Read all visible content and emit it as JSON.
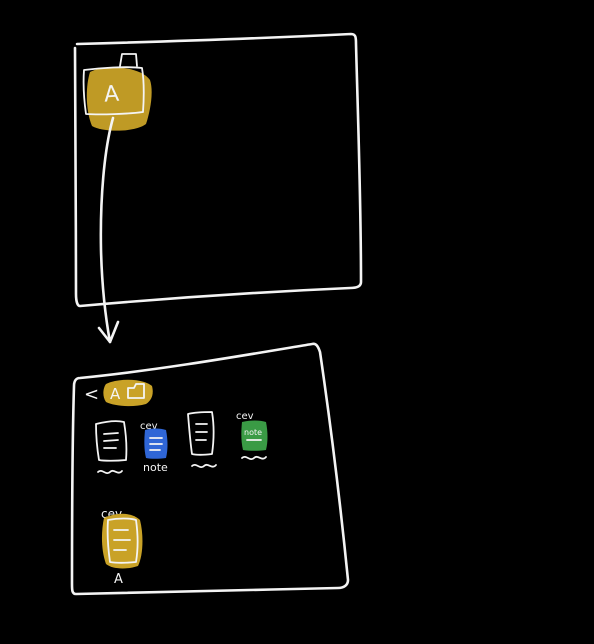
{
  "colors": {
    "background": "#000000",
    "stroke": "#f4f4f4",
    "highlight_yellow": "#c9a227",
    "note_blue": "#2f66d6",
    "note_green": "#3a9b45"
  },
  "top_screen": {
    "folder_letter": "A"
  },
  "bottom_screen": {
    "back_symbol": "<",
    "header_letter": "A",
    "files": [
      {
        "name": "plain-document",
        "tag": "",
        "caption": "~"
      },
      {
        "name": "blue-note",
        "tag": "cev",
        "caption": "note",
        "color": "#2f66d6"
      },
      {
        "name": "plain-document",
        "tag": "",
        "caption": "~"
      },
      {
        "name": "green-note",
        "tag": "cev",
        "caption": "",
        "inner_label": "note",
        "color": "#3a9b45"
      }
    ],
    "folder_item": {
      "tag": "cev",
      "label": "A"
    }
  }
}
